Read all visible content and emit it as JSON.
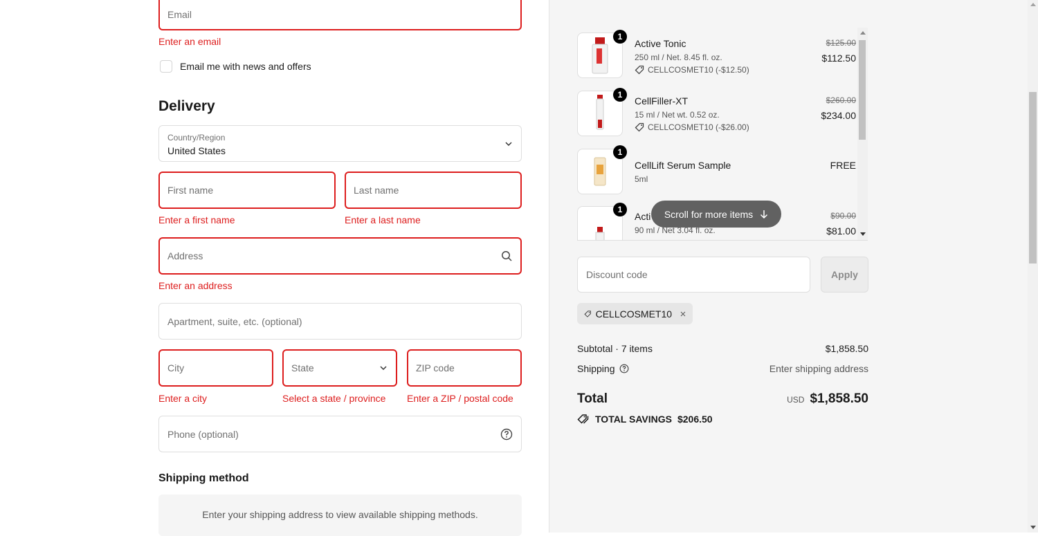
{
  "contact": {
    "email_placeholder": "Email",
    "email_error": "Enter an email",
    "newsletter_label": "Email me with news and offers"
  },
  "delivery": {
    "heading": "Delivery",
    "country_label": "Country/Region",
    "country_value": "United States",
    "first_name_placeholder": "First name",
    "first_name_error": "Enter a first name",
    "last_name_placeholder": "Last name",
    "last_name_error": "Enter a last name",
    "address_placeholder": "Address",
    "address_error": "Enter an address",
    "apartment_placeholder": "Apartment, suite, etc. (optional)",
    "city_placeholder": "City",
    "city_error": "Enter a city",
    "state_placeholder": "State",
    "state_error": "Select a state / province",
    "zip_placeholder": "ZIP code",
    "zip_error": "Enter a ZIP / postal code",
    "phone_placeholder": "Phone (optional)"
  },
  "shipping_method": {
    "heading": "Shipping method",
    "notice": "Enter your shipping address to view available shipping methods."
  },
  "order": {
    "items": [
      {
        "qty": "1",
        "name": "Active Tonic",
        "variant": "250 ml / Net. 8.45 fl. oz.",
        "discount": "CELLCOSMET10 (-$12.50)",
        "old_price": "$125.00",
        "price": "$112.50"
      },
      {
        "qty": "1",
        "name": "CellFiller-XT",
        "variant": "15 ml / Net wt. 0.52 oz.",
        "discount": "CELLCOSMET10 (-$26.00)",
        "old_price": "$260.00",
        "price": "$234.00"
      },
      {
        "qty": "1",
        "name": "CellLift Serum Sample",
        "variant": "5ml",
        "discount": "",
        "old_price": "",
        "price": "FREE"
      },
      {
        "qty": "1",
        "name": "Acti",
        "variant": "90 ml / Net 3.04 fl. oz.",
        "discount": "",
        "old_price": "$90.00",
        "price": "$81.00"
      }
    ],
    "scroll_hint": "Scroll for more items",
    "discount_placeholder": "Discount code",
    "apply_label": "Apply",
    "applied_code": "CELLCOSMET10",
    "subtotal_label": "Subtotal · 7 items",
    "subtotal_value": "$1,858.50",
    "shipping_label": "Shipping",
    "shipping_value": "Enter shipping address",
    "total_label": "Total",
    "currency": "USD",
    "total_value": "$1,858.50",
    "savings_label": "TOTAL SAVINGS",
    "savings_value": "$206.50"
  },
  "colors": {
    "error": "#dd1d1d",
    "panel": "#f5f5f5"
  }
}
